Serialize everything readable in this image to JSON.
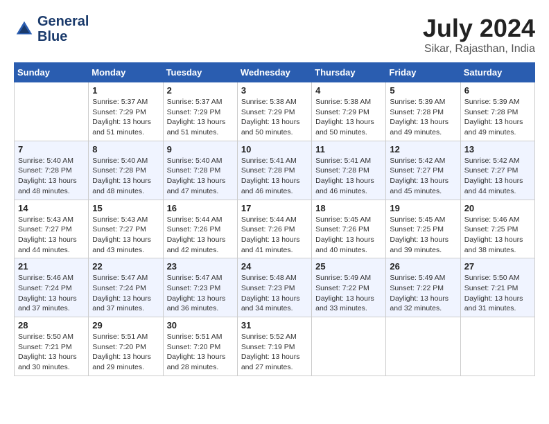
{
  "header": {
    "logo_line1": "General",
    "logo_line2": "Blue",
    "month_year": "July 2024",
    "location": "Sikar, Rajasthan, India"
  },
  "weekdays": [
    "Sunday",
    "Monday",
    "Tuesday",
    "Wednesday",
    "Thursday",
    "Friday",
    "Saturday"
  ],
  "weeks": [
    [
      {
        "day": "",
        "sunrise": "",
        "sunset": "",
        "daylight": ""
      },
      {
        "day": "1",
        "sunrise": "Sunrise: 5:37 AM",
        "sunset": "Sunset: 7:29 PM",
        "daylight": "Daylight: 13 hours and 51 minutes."
      },
      {
        "day": "2",
        "sunrise": "Sunrise: 5:37 AM",
        "sunset": "Sunset: 7:29 PM",
        "daylight": "Daylight: 13 hours and 51 minutes."
      },
      {
        "day": "3",
        "sunrise": "Sunrise: 5:38 AM",
        "sunset": "Sunset: 7:29 PM",
        "daylight": "Daylight: 13 hours and 50 minutes."
      },
      {
        "day": "4",
        "sunrise": "Sunrise: 5:38 AM",
        "sunset": "Sunset: 7:29 PM",
        "daylight": "Daylight: 13 hours and 50 minutes."
      },
      {
        "day": "5",
        "sunrise": "Sunrise: 5:39 AM",
        "sunset": "Sunset: 7:28 PM",
        "daylight": "Daylight: 13 hours and 49 minutes."
      },
      {
        "day": "6",
        "sunrise": "Sunrise: 5:39 AM",
        "sunset": "Sunset: 7:28 PM",
        "daylight": "Daylight: 13 hours and 49 minutes."
      }
    ],
    [
      {
        "day": "7",
        "sunrise": "Sunrise: 5:40 AM",
        "sunset": "Sunset: 7:28 PM",
        "daylight": "Daylight: 13 hours and 48 minutes."
      },
      {
        "day": "8",
        "sunrise": "Sunrise: 5:40 AM",
        "sunset": "Sunset: 7:28 PM",
        "daylight": "Daylight: 13 hours and 48 minutes."
      },
      {
        "day": "9",
        "sunrise": "Sunrise: 5:40 AM",
        "sunset": "Sunset: 7:28 PM",
        "daylight": "Daylight: 13 hours and 47 minutes."
      },
      {
        "day": "10",
        "sunrise": "Sunrise: 5:41 AM",
        "sunset": "Sunset: 7:28 PM",
        "daylight": "Daylight: 13 hours and 46 minutes."
      },
      {
        "day": "11",
        "sunrise": "Sunrise: 5:41 AM",
        "sunset": "Sunset: 7:28 PM",
        "daylight": "Daylight: 13 hours and 46 minutes."
      },
      {
        "day": "12",
        "sunrise": "Sunrise: 5:42 AM",
        "sunset": "Sunset: 7:27 PM",
        "daylight": "Daylight: 13 hours and 45 minutes."
      },
      {
        "day": "13",
        "sunrise": "Sunrise: 5:42 AM",
        "sunset": "Sunset: 7:27 PM",
        "daylight": "Daylight: 13 hours and 44 minutes."
      }
    ],
    [
      {
        "day": "14",
        "sunrise": "Sunrise: 5:43 AM",
        "sunset": "Sunset: 7:27 PM",
        "daylight": "Daylight: 13 hours and 44 minutes."
      },
      {
        "day": "15",
        "sunrise": "Sunrise: 5:43 AM",
        "sunset": "Sunset: 7:27 PM",
        "daylight": "Daylight: 13 hours and 43 minutes."
      },
      {
        "day": "16",
        "sunrise": "Sunrise: 5:44 AM",
        "sunset": "Sunset: 7:26 PM",
        "daylight": "Daylight: 13 hours and 42 minutes."
      },
      {
        "day": "17",
        "sunrise": "Sunrise: 5:44 AM",
        "sunset": "Sunset: 7:26 PM",
        "daylight": "Daylight: 13 hours and 41 minutes."
      },
      {
        "day": "18",
        "sunrise": "Sunrise: 5:45 AM",
        "sunset": "Sunset: 7:26 PM",
        "daylight": "Daylight: 13 hours and 40 minutes."
      },
      {
        "day": "19",
        "sunrise": "Sunrise: 5:45 AM",
        "sunset": "Sunset: 7:25 PM",
        "daylight": "Daylight: 13 hours and 39 minutes."
      },
      {
        "day": "20",
        "sunrise": "Sunrise: 5:46 AM",
        "sunset": "Sunset: 7:25 PM",
        "daylight": "Daylight: 13 hours and 38 minutes."
      }
    ],
    [
      {
        "day": "21",
        "sunrise": "Sunrise: 5:46 AM",
        "sunset": "Sunset: 7:24 PM",
        "daylight": "Daylight: 13 hours and 37 minutes."
      },
      {
        "day": "22",
        "sunrise": "Sunrise: 5:47 AM",
        "sunset": "Sunset: 7:24 PM",
        "daylight": "Daylight: 13 hours and 37 minutes."
      },
      {
        "day": "23",
        "sunrise": "Sunrise: 5:47 AM",
        "sunset": "Sunset: 7:23 PM",
        "daylight": "Daylight: 13 hours and 36 minutes."
      },
      {
        "day": "24",
        "sunrise": "Sunrise: 5:48 AM",
        "sunset": "Sunset: 7:23 PM",
        "daylight": "Daylight: 13 hours and 34 minutes."
      },
      {
        "day": "25",
        "sunrise": "Sunrise: 5:49 AM",
        "sunset": "Sunset: 7:22 PM",
        "daylight": "Daylight: 13 hours and 33 minutes."
      },
      {
        "day": "26",
        "sunrise": "Sunrise: 5:49 AM",
        "sunset": "Sunset: 7:22 PM",
        "daylight": "Daylight: 13 hours and 32 minutes."
      },
      {
        "day": "27",
        "sunrise": "Sunrise: 5:50 AM",
        "sunset": "Sunset: 7:21 PM",
        "daylight": "Daylight: 13 hours and 31 minutes."
      }
    ],
    [
      {
        "day": "28",
        "sunrise": "Sunrise: 5:50 AM",
        "sunset": "Sunset: 7:21 PM",
        "daylight": "Daylight: 13 hours and 30 minutes."
      },
      {
        "day": "29",
        "sunrise": "Sunrise: 5:51 AM",
        "sunset": "Sunset: 7:20 PM",
        "daylight": "Daylight: 13 hours and 29 minutes."
      },
      {
        "day": "30",
        "sunrise": "Sunrise: 5:51 AM",
        "sunset": "Sunset: 7:20 PM",
        "daylight": "Daylight: 13 hours and 28 minutes."
      },
      {
        "day": "31",
        "sunrise": "Sunrise: 5:52 AM",
        "sunset": "Sunset: 7:19 PM",
        "daylight": "Daylight: 13 hours and 27 minutes."
      },
      {
        "day": "",
        "sunrise": "",
        "sunset": "",
        "daylight": ""
      },
      {
        "day": "",
        "sunrise": "",
        "sunset": "",
        "daylight": ""
      },
      {
        "day": "",
        "sunrise": "",
        "sunset": "",
        "daylight": ""
      }
    ]
  ]
}
